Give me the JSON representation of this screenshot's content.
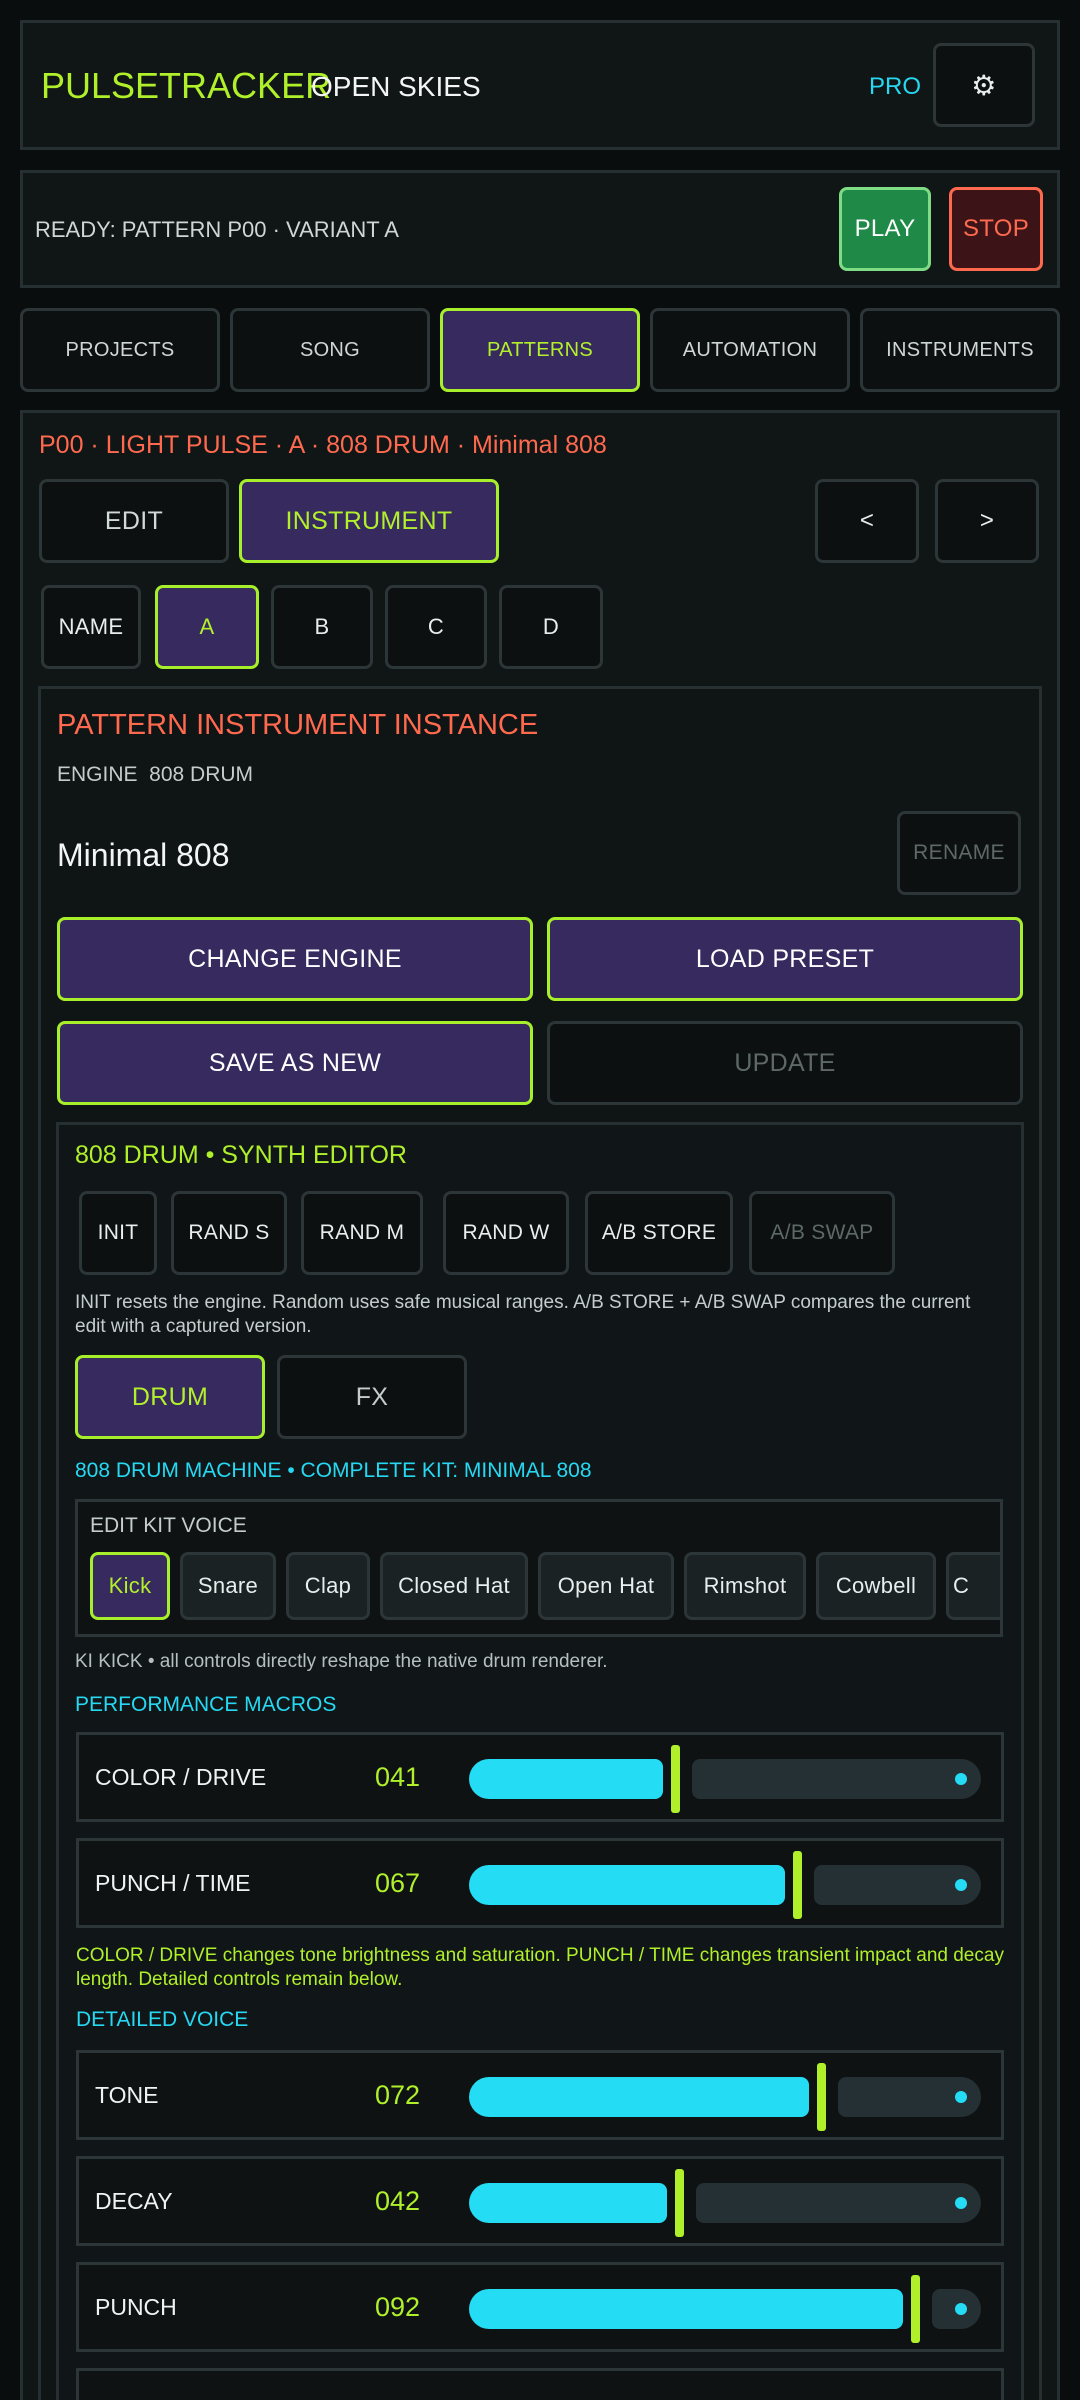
{
  "header": {
    "app_name": "PULSETRACKER",
    "project_name": "OPEN SKIES",
    "pro_badge": "PRO",
    "settings_icon": "gear-icon",
    "settings_glyph": "⚙"
  },
  "transport": {
    "status": "READY: PATTERN P00 · VARIANT A",
    "play_label": "PLAY",
    "stop_label": "STOP"
  },
  "tabs": [
    {
      "label": "PROJECTS",
      "selected": false
    },
    {
      "label": "SONG",
      "selected": false
    },
    {
      "label": "PATTERNS",
      "selected": true
    },
    {
      "label": "AUTOMATION",
      "selected": false
    },
    {
      "label": "INSTRUMENTS",
      "selected": false
    }
  ],
  "pattern": {
    "title": "P00 · LIGHT PULSE · A · 808 DRUM · Minimal 808",
    "mode_edit": "EDIT",
    "mode_instrument": "INSTRUMENT",
    "prev_label": "<",
    "next_label": ">",
    "variants": [
      "NAME",
      "A",
      "B",
      "C",
      "D"
    ]
  },
  "instance": {
    "heading": "PATTERN INSTRUMENT INSTANCE",
    "engine_line": "ENGINE  808 DRUM",
    "preset_name": "Minimal 808",
    "rename_label": "RENAME",
    "change_engine_label": "CHANGE ENGINE",
    "load_preset_label": "LOAD PRESET",
    "save_as_new_label": "SAVE AS NEW",
    "update_label": "UPDATE"
  },
  "editor": {
    "heading": "808 DRUM • SYNTH EDITOR",
    "actions": [
      "INIT",
      "RAND S",
      "RAND M",
      "RAND W",
      "A/B STORE",
      "A/B SWAP"
    ],
    "help": "INIT resets the engine. Random uses safe musical ranges. A/B STORE + A/B SWAP compares the current edit with a captured version.",
    "tab_drum": "DRUM",
    "tab_fx": "FX",
    "kit_line": "808 DRUM MACHINE • COMPLETE KIT: MINIMAL 808",
    "kit_voice_label": "EDIT KIT VOICE",
    "voices": [
      "Kick",
      "Snare",
      "Clap",
      "Closed Hat",
      "Open Hat",
      "Rimshot",
      "Cowbell",
      "C"
    ],
    "voice_note": "KI KICK • all controls directly reshape the native drum renderer.",
    "macros_heading": "PERFORMANCE MACROS",
    "macros": [
      {
        "label": "COLOR / DRIVE",
        "value": "041",
        "level": 0.41
      },
      {
        "label": "PUNCH / TIME",
        "value": "067",
        "level": 0.67
      }
    ],
    "macros_note": "COLOR / DRIVE changes tone brightness and saturation. PUNCH / TIME changes transient impact and decay length. Detailed controls remain below.",
    "detail_heading": "DETAILED VOICE",
    "detail": [
      {
        "label": "TONE",
        "value": "072",
        "level": 0.72
      },
      {
        "label": "DECAY",
        "value": "042",
        "level": 0.42
      },
      {
        "label": "PUNCH",
        "value": "092",
        "level": 0.92
      }
    ]
  },
  "colors": {
    "accent_lime": "#b0f02a",
    "accent_cyan": "#26d8f2",
    "accent_coral": "#ff6a4f",
    "selected_bg": "#362a5e",
    "play_green": "#1f8a48",
    "stop_red": "#ff6a4f"
  }
}
